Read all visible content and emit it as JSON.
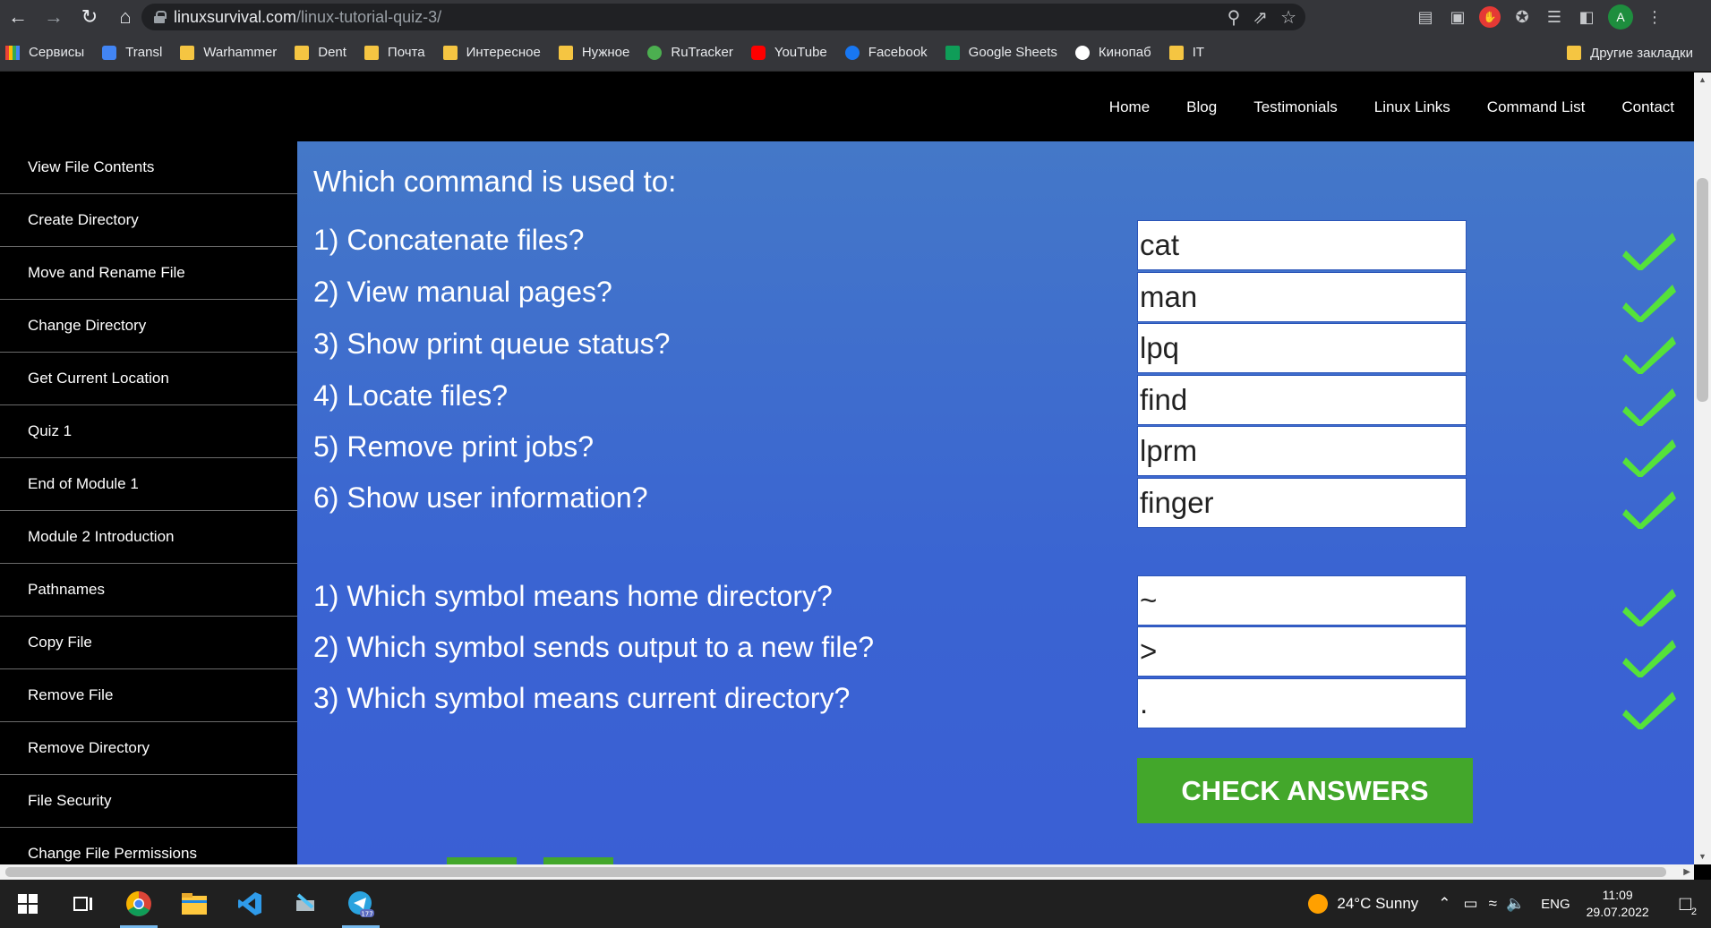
{
  "browser": {
    "url_host": "linuxsurvival.com",
    "url_path": "/linux-tutorial-quiz-3/",
    "profile_initial": "A",
    "bookmarks": [
      {
        "label": "Сервисы",
        "icon": "apps-grid-icon"
      },
      {
        "label": "Transl",
        "icon": "google-translate-icon"
      },
      {
        "label": "Warhammer",
        "icon": "folder-icon"
      },
      {
        "label": "Dent",
        "icon": "folder-icon"
      },
      {
        "label": "Почта",
        "icon": "folder-icon"
      },
      {
        "label": "Интересное",
        "icon": "folder-icon"
      },
      {
        "label": "Нужное",
        "icon": "folder-icon"
      },
      {
        "label": "RuTracker",
        "icon": "rutracker-icon"
      },
      {
        "label": "YouTube",
        "icon": "youtube-icon"
      },
      {
        "label": "Facebook",
        "icon": "facebook-icon"
      },
      {
        "label": "Google Sheets",
        "icon": "google-sheets-icon"
      },
      {
        "label": "Кинопаб",
        "icon": "kinopub-icon"
      },
      {
        "label": "IT",
        "icon": "folder-icon"
      }
    ],
    "other_bookmarks": "Другие закладки"
  },
  "site_nav": [
    "Home",
    "Blog",
    "Testimonials",
    "Linux Links",
    "Command List",
    "Contact"
  ],
  "sidebar": [
    "View File Contents",
    "Create Directory",
    "Move and Rename File",
    "Change Directory",
    "Get Current Location",
    "Quiz 1",
    "End of Module 1",
    "Module 2 Introduction",
    "Pathnames",
    "Copy File",
    "Remove File",
    "Remove Directory",
    "File Security",
    "Change File Permissions"
  ],
  "quiz": {
    "title": "Which command is used to:",
    "questions": [
      {
        "text": "1) Concatenate files?",
        "answer": "cat",
        "correct": true
      },
      {
        "text": "2) View manual pages?",
        "answer": "man",
        "correct": true
      },
      {
        "text": "3) Show print queue status?",
        "answer": "lpq",
        "correct": true
      },
      {
        "text": "4) Locate files?",
        "answer": "find",
        "correct": true
      },
      {
        "text": "5) Remove print jobs?",
        "answer": "lprm",
        "correct": true
      },
      {
        "text": "6) Show user information?",
        "answer": "finger",
        "correct": true
      },
      {
        "text": "1) Which symbol means home directory?",
        "answer": "~",
        "correct": true
      },
      {
        "text": "2) Which symbol sends output to a new file?",
        "answer": ">",
        "correct": true
      },
      {
        "text": "3) Which symbol means current directory?",
        "answer": ".",
        "correct": true
      }
    ],
    "submit_label": "CHECK ANSWERS",
    "check_color": "#55e23a",
    "button_color": "#43a72b"
  },
  "taskbar": {
    "weather": "24°C  Sunny",
    "language": "ENG",
    "time": "11:09",
    "date": "29.07.2022",
    "telegram_badge": "177",
    "notification_count": "2"
  }
}
